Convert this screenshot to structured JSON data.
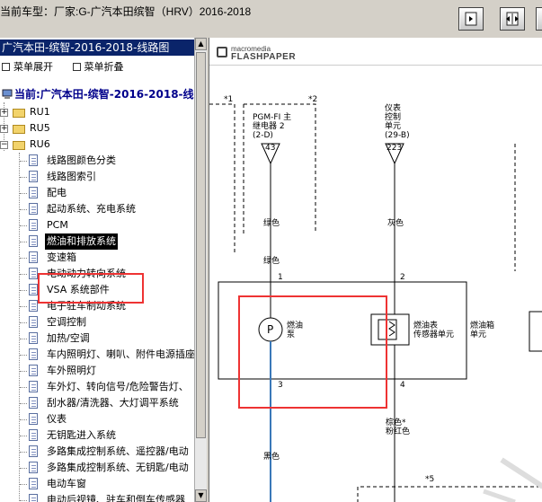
{
  "header": {
    "title": "当前车型：厂家:G-广汽本田缤智（HRV）2016-2018"
  },
  "toolbar": {
    "buttons": [
      "fit-page-icon",
      "fit-width-icon",
      "next-icon"
    ]
  },
  "sidebar": {
    "heading": "广汽本田-缤智-2016-2018-线路图",
    "expand_label": "菜单展开",
    "collapse_label": "菜单折叠",
    "root_label": "当前:广汽本田-缤智-2016-2018-线",
    "folders": [
      "RU1",
      "RU5",
      "RU6"
    ],
    "items": [
      "线路图颜色分类",
      "线路图索引",
      "配电",
      "起动系统、充电系统",
      "PCM",
      "燃油和排放系统",
      "变速箱",
      "电动动力转向系统",
      "VSA 系统部件",
      "电子驻车制动系统",
      "空调控制",
      "加热/空调",
      "车内照明灯、喇叭、附件电源插座",
      "车外照明灯",
      "车外灯、转向信号/危险警告灯、",
      "刮水器/清洗器、大灯调平系统",
      "仪表",
      "无钥匙进入系统",
      "多路集成控制系统、遥控器/电动",
      "多路集成控制系统、无钥匙/电动",
      "电动车窗",
      "电动后视镜、驻车和倒车传感器"
    ],
    "selected_index": 5
  },
  "viewer": {
    "logo_line1": "macromedia",
    "logo_line2": "FLASHPAPER",
    "marks": [
      "*1",
      "*2",
      "*5"
    ],
    "pgm_label": [
      "PGM-FI 主",
      "继电器 2",
      "(2-D)"
    ],
    "pgm_pin": "43",
    "meter_label": [
      "仪表",
      "控制",
      "单元",
      "(29-B)"
    ],
    "meter_pin": "223",
    "wire_green_1": "绿色",
    "wire_green_2": "绿色",
    "wire_gray": "灰色",
    "pin1": "1",
    "pin2": "2",
    "pin3": "3",
    "pin4": "4",
    "pump_symbol": "P",
    "pump_label": [
      "燃油",
      "泵"
    ],
    "sensor_label": [
      "燃油表",
      "传感器单元"
    ],
    "unit_label": [
      "燃油箱",
      "单元"
    ],
    "wire_pink": [
      "棕色*",
      "粉红色"
    ],
    "wire_black": "黑色"
  }
}
